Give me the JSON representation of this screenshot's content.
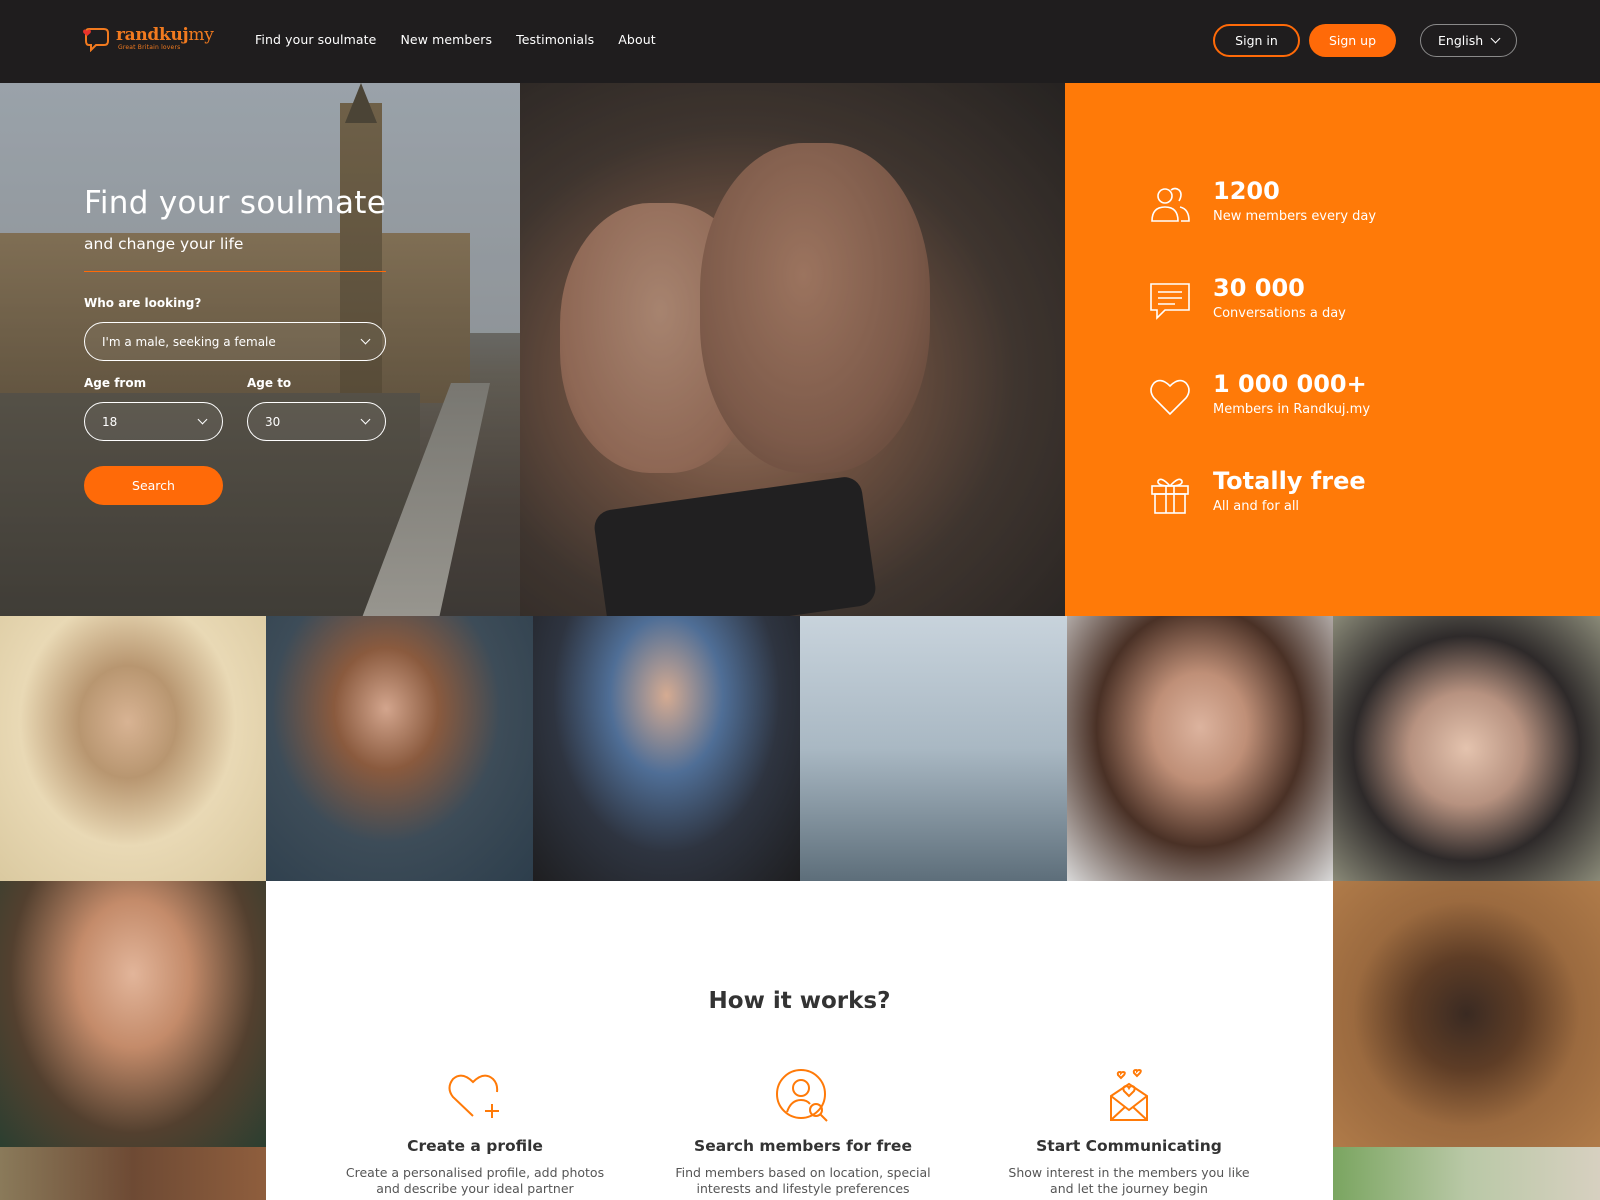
{
  "brand": {
    "name_bold": "randkuj",
    "name_light": "my",
    "tagline": "Great Britain lovers",
    "accent": "#ff6a08"
  },
  "nav": {
    "items": [
      "Find your soulmate",
      "New members",
      "Testimonials",
      "About"
    ]
  },
  "header": {
    "signin": "Sign in",
    "signup": "Sign up",
    "language": "English"
  },
  "hero": {
    "title": "Find your soulmate",
    "subtitle": "and change your life",
    "who_label": "Who are looking?",
    "who_value": "I'm a male, seeking a female",
    "age_from_label": "Age from",
    "age_from_value": "18",
    "age_to_label": "Age to",
    "age_to_value": "30",
    "search": "Search"
  },
  "stats": [
    {
      "number": "1200",
      "caption": "New members every day",
      "icon": "people-icon"
    },
    {
      "number": "30 000",
      "caption": "Conversations a day",
      "icon": "chat-icon"
    },
    {
      "number": "1 000 000+",
      "caption": "Members in Randkuj.my",
      "icon": "heart-icon"
    },
    {
      "number": "Totally free",
      "caption": "All and for all",
      "icon": "gift-icon"
    }
  ],
  "how": {
    "title": "How it works?",
    "steps": [
      {
        "title": "Create a profile",
        "desc_1": "Create a personalised profile, add photos",
        "desc_2": "and describe your ideal partner",
        "icon": "heart-plus-icon"
      },
      {
        "title": "Search members for free",
        "desc_1": "Find members based on location, special",
        "desc_2": "interests and lifestyle preferences",
        "icon": "user-search-icon"
      },
      {
        "title": "Start Communicating",
        "desc_1": "Show interest in the members you like",
        "desc_2": "and let the journey begin",
        "icon": "love-letter-icon"
      }
    ]
  }
}
